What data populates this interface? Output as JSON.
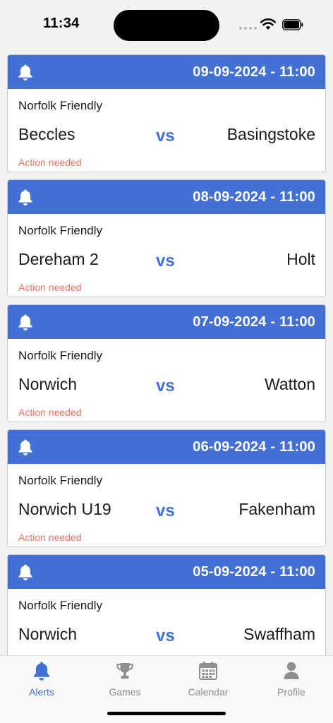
{
  "status_bar": {
    "time": "11:34"
  },
  "colors": {
    "accent": "#4270d4",
    "action_needed": "#f07060",
    "tab_inactive": "#8e8e93"
  },
  "alerts": [
    {
      "date_time": "09-09-2024 - 11:00",
      "competition": "Norfolk Friendly",
      "home_team": "Beccles",
      "vs": "vs",
      "away_team": "Basingstoke",
      "status": "Action needed",
      "icon": "bell-icon"
    },
    {
      "date_time": "08-09-2024 - 11:00",
      "competition": "Norfolk Friendly",
      "home_team": "Dereham 2",
      "vs": "vs",
      "away_team": "Holt",
      "status": "Action needed",
      "icon": "bell-icon"
    },
    {
      "date_time": "07-09-2024 - 11:00",
      "competition": "Norfolk Friendly",
      "home_team": "Norwich",
      "vs": "vs",
      "away_team": "Watton",
      "status": "Action needed",
      "icon": "bell-icon"
    },
    {
      "date_time": "06-09-2024 - 11:00",
      "competition": "Norfolk Friendly",
      "home_team": "Norwich U19",
      "vs": "vs",
      "away_team": "Fakenham",
      "status": "Action needed",
      "icon": "bell-icon"
    },
    {
      "date_time": "05-09-2024 - 11:00",
      "competition": "Norfolk Friendly",
      "home_team": "Norwich",
      "vs": "vs",
      "away_team": "Swaffham",
      "status": "",
      "icon": "bell-icon"
    }
  ],
  "tabs": [
    {
      "label": "Alerts",
      "icon": "bell-icon",
      "active": true
    },
    {
      "label": "Games",
      "icon": "trophy-icon",
      "active": false
    },
    {
      "label": "Calendar",
      "icon": "calendar-icon",
      "active": false
    },
    {
      "label": "Profile",
      "icon": "person-icon",
      "active": false
    }
  ]
}
